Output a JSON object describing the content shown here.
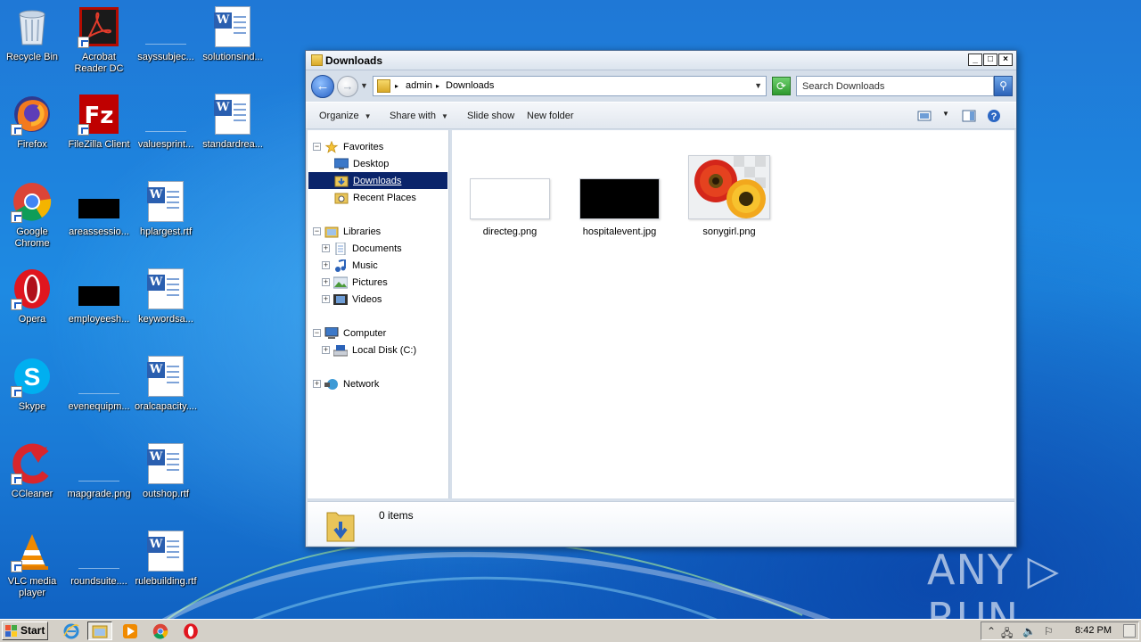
{
  "desktop": {
    "icons": [
      {
        "label": "Recycle Bin",
        "icon": "recycle-bin-icon"
      },
      {
        "label": "Acrobat Reader DC",
        "line1": "Acrobat",
        "line2": "Reader DC",
        "icon": "acrobat-icon"
      },
      {
        "label": "sayssubjec...",
        "icon": "blank-file-icon"
      },
      {
        "label": "solutionsind...",
        "icon": "word-doc-icon"
      },
      {
        "label": "Firefox",
        "icon": "firefox-icon"
      },
      {
        "label": "FileZilla Client",
        "icon": "filezilla-icon"
      },
      {
        "label": "valuesprint...",
        "icon": "blank-file-icon"
      },
      {
        "label": "standardrea...",
        "icon": "word-doc-icon"
      },
      {
        "label": "Google Chrome",
        "line1": "Google",
        "line2": "Chrome",
        "icon": "chrome-icon"
      },
      {
        "label": "areassessio...",
        "icon": "black-image-icon"
      },
      {
        "label": "hplargest.rtf",
        "icon": "word-doc-icon"
      },
      {
        "label": "Opera",
        "icon": "opera-icon"
      },
      {
        "label": "employeesh...",
        "icon": "black-image-icon"
      },
      {
        "label": "keywordsa...",
        "icon": "word-doc-icon"
      },
      {
        "label": "Skype",
        "icon": "skype-icon"
      },
      {
        "label": "evenequipm...",
        "icon": "blank-file-icon"
      },
      {
        "label": "oralcapacity....",
        "icon": "word-doc-icon"
      },
      {
        "label": "CCleaner",
        "icon": "ccleaner-icon"
      },
      {
        "label": "mapgrade.png",
        "icon": "blank-file-icon"
      },
      {
        "label": "outshop.rtf",
        "icon": "word-doc-icon"
      },
      {
        "label": "VLC media player",
        "line1": "VLC media",
        "line2": "player",
        "icon": "vlc-icon"
      },
      {
        "label": "roundsuite....",
        "icon": "blank-file-icon"
      },
      {
        "label": "rulebuilding.rtf",
        "icon": "word-doc-icon"
      }
    ]
  },
  "window": {
    "title": "Downloads",
    "controls": {
      "minimize": "_",
      "maximize": "□",
      "close": "×"
    },
    "address": {
      "crumbs": [
        "admin",
        "Downloads"
      ]
    },
    "search": {
      "placeholder": "Search Downloads"
    },
    "toolbar": {
      "organize": "Organize",
      "share_with": "Share with",
      "slide_show": "Slide show",
      "new_folder": "New folder"
    },
    "nav": {
      "favorites": "Favorites",
      "desktop": "Desktop",
      "downloads": "Downloads",
      "recent_places": "Recent Places",
      "libraries": "Libraries",
      "documents": "Documents",
      "music": "Music",
      "pictures": "Pictures",
      "videos": "Videos",
      "computer": "Computer",
      "local_disk": "Local Disk (C:)",
      "network": "Network"
    },
    "files": [
      {
        "name": "directeg.png",
        "thumb": "white"
      },
      {
        "name": "hospitalevent.jpg",
        "thumb": "black"
      },
      {
        "name": "sonygirl.png",
        "thumb": "flowers"
      }
    ],
    "details": {
      "text": "0 items"
    }
  },
  "watermark": "ANY ▷ RUN",
  "taskbar": {
    "start": "Start",
    "apps": [
      "internet-explorer-icon",
      "explorer-icon",
      "media-player-icon",
      "chrome-icon",
      "opera-icon"
    ],
    "clock": "8:42 PM"
  },
  "colors": {
    "selection": "#0a246a",
    "desktop": "#1e8ae2"
  }
}
